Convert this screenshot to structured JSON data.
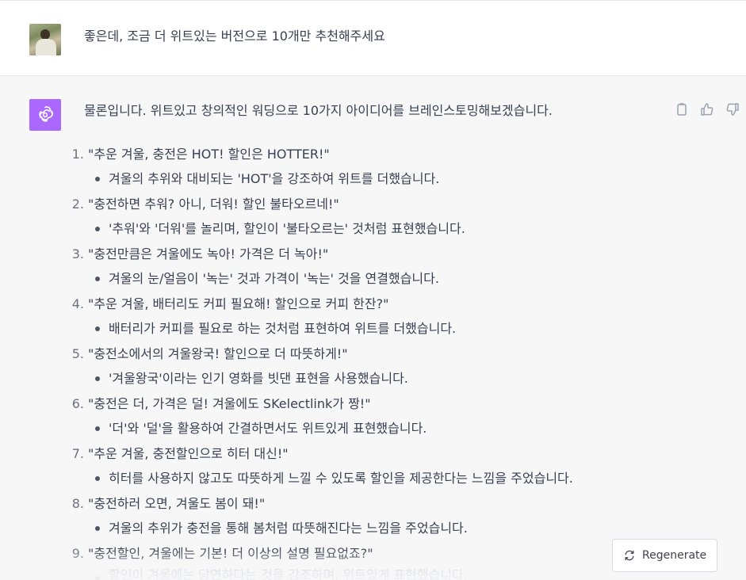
{
  "user_message": {
    "text": "좋은데, 조금 더 위트있는 버전으로 10개만 추천해주세요"
  },
  "assistant_message": {
    "intro": "물론입니다. 위트있고 창의적인 워딩으로 10가지 아이디어를 브레인스토밍해보겠습니다.",
    "items": [
      {
        "num": "1.",
        "title": "\"추운 겨울, 충전은 HOT! 할인은 HOTTER!\"",
        "note": "겨울의 추위와 대비되는 'HOT'을 강조하여 위트를 더했습니다."
      },
      {
        "num": "2.",
        "title": "\"충전하면 추워? 아니, 더워! 할인 불타오르네!\"",
        "note": "'추워'와 '더워'를 놀리며, 할인이 '불타오르는' 것처럼 표현했습니다."
      },
      {
        "num": "3.",
        "title": "\"충전만큼은 겨울에도 녹아! 가격은 더 녹아!\"",
        "note": "겨울의 눈/얼음이 '녹는' 것과 가격이 '녹는' 것을 연결했습니다."
      },
      {
        "num": "4.",
        "title": "\"추운 겨울, 배터리도 커피 필요해! 할인으로 커피 한잔?\"",
        "note": "배터리가 커피를 필요로 하는 것처럼 표현하여 위트를 더했습니다."
      },
      {
        "num": "5.",
        "title": "\"충전소에서의 겨울왕국! 할인으로 더 따뜻하게!\"",
        "note": "'겨울왕국'이라는 인기 영화를 빗댄 표현을 사용했습니다."
      },
      {
        "num": "6.",
        "title": "\"충전은 더, 가격은 덜! 겨울에도 SKelectlink가 짱!\"",
        "note": "'더'와 '덜'을 활용하여 간결하면서도 위트있게 표현했습니다."
      },
      {
        "num": "7.",
        "title": "\"추운 겨울, 충전할인으로 히터 대신!\"",
        "note": "히터를 사용하지 않고도 따뜻하게 느낄 수 있도록 할인을 제공한다는 느낌을 주었습니다."
      },
      {
        "num": "8.",
        "title": "\"충전하러 오면, 겨울도 봄이 돼!\"",
        "note": "겨울의 추위가 충전을 통해 봄처럼 따뜻해진다는 느낌을 주었습니다."
      },
      {
        "num": "9.",
        "title": "\"충전할인, 겨울에는 기본! 더 이상의 설명 필요없죠?\"",
        "note": "할인이 겨울에는 당연하다는 것을 강조하며, 위트있게 표현했습니다."
      }
    ]
  },
  "actions": {
    "copy_icon": "clipboard-icon",
    "thumbs_up_icon": "thumbs-up-icon",
    "thumbs_down_icon": "thumbs-down-icon"
  },
  "regenerate": {
    "label": "Regenerate",
    "icon": "refresh-icon"
  },
  "colors": {
    "assistant_avatar_bg": "#ab68ff",
    "assistant_row_bg": "#f7f7f8",
    "text": "#374151"
  }
}
